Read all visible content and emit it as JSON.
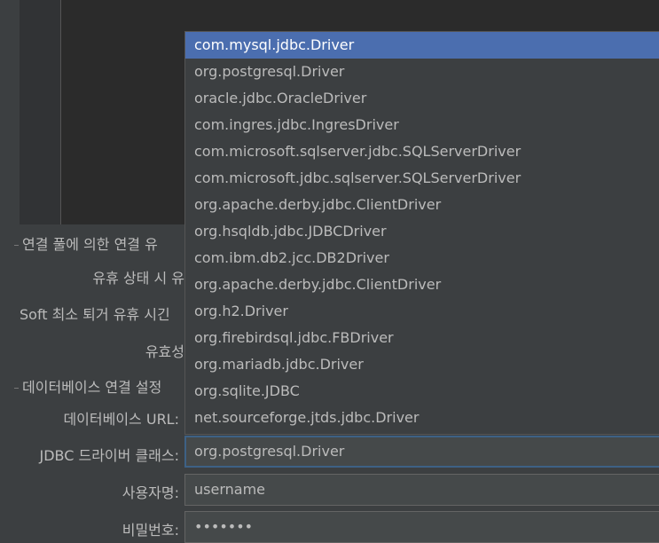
{
  "section_pool": "연결 풀에 의한 연결 유",
  "labels": {
    "idle_state": "유휴 상태 시 유",
    "soft_min": "Soft 최소 퇴거 유휴 시긴",
    "validity": "유효성",
    "db_url": "데이터베이스 URL:",
    "jdbc_driver_class": "JDBC 드라이버 클래스:",
    "username": "사용자명:",
    "password": "비밀번호:"
  },
  "section_db": "데이터베이스 연결 설정",
  "fields": {
    "jdbc_driver_class": "org.postgresql.Driver",
    "username": "username",
    "password": "•••••••"
  },
  "dropdown": {
    "selected_index": 0,
    "items": [
      "com.mysql.jdbc.Driver",
      "org.postgresql.Driver",
      "oracle.jdbc.OracleDriver",
      "com.ingres.jdbc.IngresDriver",
      "com.microsoft.sqlserver.jdbc.SQLServerDriver",
      "com.microsoft.jdbc.sqlserver.SQLServerDriver",
      "org.apache.derby.jdbc.ClientDriver",
      "org.hsqldb.jdbc.JDBCDriver",
      "com.ibm.db2.jcc.DB2Driver",
      "org.apache.derby.jdbc.ClientDriver",
      "org.h2.Driver",
      "org.firebirdsql.jdbc.FBDriver",
      "org.mariadb.jdbc.Driver",
      "org.sqlite.JDBC",
      "net.sourceforge.jtds.jdbc.Driver"
    ]
  }
}
